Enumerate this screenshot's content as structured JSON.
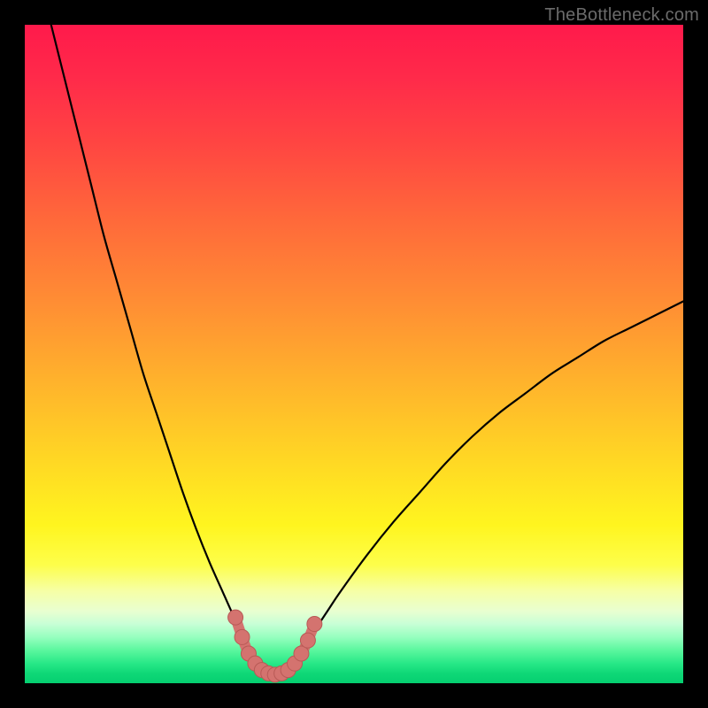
{
  "watermark": "TheBottleneck.com",
  "colors": {
    "frame": "#000000",
    "curve": "#000000",
    "marker_fill": "#d4736f",
    "marker_stroke": "#b85a56"
  },
  "chart_data": {
    "type": "line",
    "title": "",
    "xlabel": "",
    "ylabel": "",
    "xlim": [
      0,
      100
    ],
    "ylim": [
      0,
      100
    ],
    "grid": false,
    "legend": false,
    "series": [
      {
        "name": "left-branch",
        "x": [
          4,
          6,
          8,
          10,
          12,
          14,
          16,
          18,
          20,
          22,
          24,
          26,
          28,
          30,
          32,
          33,
          34,
          35
        ],
        "y": [
          100,
          92,
          84,
          76,
          68,
          61,
          54,
          47,
          41,
          35,
          29,
          23.5,
          18.5,
          14,
          9.5,
          7,
          5,
          3.5
        ]
      },
      {
        "name": "right-branch",
        "x": [
          41,
          42,
          44,
          46,
          48,
          52,
          56,
          60,
          64,
          68,
          72,
          76,
          80,
          84,
          88,
          92,
          96,
          100
        ],
        "y": [
          3.5,
          5,
          8,
          11,
          14,
          19.5,
          24.5,
          29,
          33.5,
          37.5,
          41,
          44,
          47,
          49.5,
          52,
          54,
          56,
          58
        ]
      },
      {
        "name": "valley-markers",
        "x": [
          32,
          33,
          34,
          35,
          36,
          37,
          38,
          39,
          40,
          41,
          42,
          43,
          44
        ],
        "y": [
          10,
          7,
          4.5,
          3,
          2,
          1.5,
          1.3,
          1.5,
          2,
          3,
          4.5,
          6.5,
          9
        ]
      }
    ]
  }
}
